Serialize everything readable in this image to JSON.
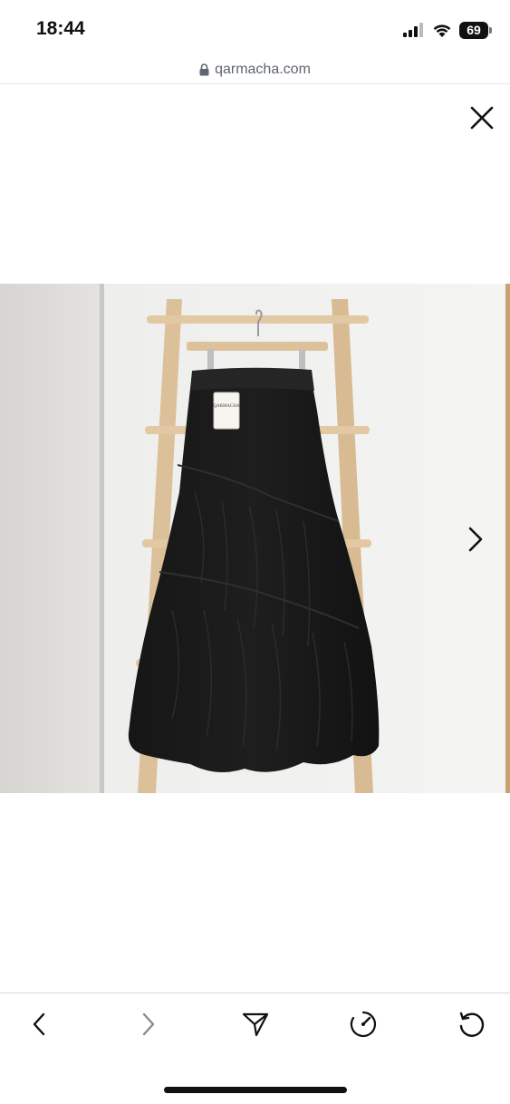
{
  "status": {
    "time": "18:44",
    "battery": "69"
  },
  "browser": {
    "url": "qarmacha.com"
  },
  "lightbox": {
    "image_alt": "Black tiered crinkle maxi skirt hanging on wooden ladder",
    "tag_text": "QARMACHA"
  },
  "icons": {
    "close": "close-icon",
    "next": "chevron-right-icon",
    "back": "back-icon",
    "forward": "forward-icon",
    "share": "share-icon",
    "speed": "speedometer-icon",
    "reload": "reload-icon"
  }
}
